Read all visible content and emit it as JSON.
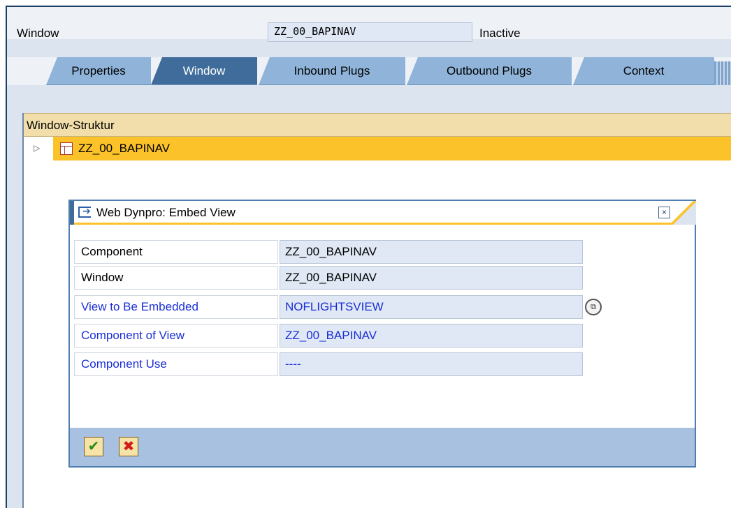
{
  "header": {
    "window_label": "Window",
    "window_value": "ZZ_00_BAPINAV",
    "status": "Inactive"
  },
  "tabs": [
    {
      "label": "Properties",
      "active": false
    },
    {
      "label": "Window",
      "active": true
    },
    {
      "label": "Inbound Plugs",
      "active": false
    },
    {
      "label": "Outbound Plugs",
      "active": false
    },
    {
      "label": "Context",
      "active": false
    }
  ],
  "tree": {
    "header": "Window-Struktur",
    "expand_glyph": "▷",
    "node_label": "ZZ_00_BAPINAV"
  },
  "dialog": {
    "title": "Web Dynpro: Embed View",
    "close_glyph": "×",
    "fields": [
      {
        "label": "Component",
        "value": "ZZ_00_BAPINAV",
        "link": false
      },
      {
        "label": "Window",
        "value": "ZZ_00_BAPINAV",
        "link": false
      },
      {
        "label": "View to Be Embedded",
        "value": "NOFLIGHTSVIEW",
        "link": true
      },
      {
        "label": "Component of View",
        "value": "ZZ_00_BAPINAV",
        "link": true
      },
      {
        "label": "Component Use",
        "value": "----",
        "link": true
      }
    ],
    "f4_glyph": "⧉",
    "ok_glyph": "✔",
    "cancel_glyph": "✖"
  }
}
